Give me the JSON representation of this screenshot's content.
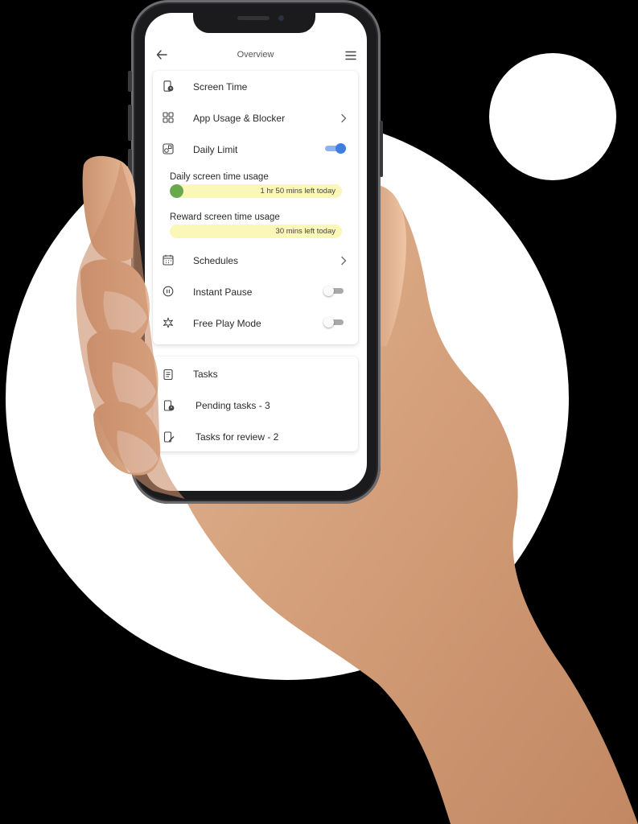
{
  "header": {
    "title": "Overview",
    "back_icon": "arrow-left-icon",
    "menu_icon": "hamburger-menu-icon"
  },
  "controls": {
    "rows": [
      {
        "label": "Screen Time",
        "icon": "phone-clock-icon"
      },
      {
        "label": "App Usage & Blocker",
        "icon": "apps-grid-icon",
        "has_chevron": true
      },
      {
        "label": "Daily Limit",
        "icon": "limit-icon",
        "toggle": "on"
      },
      {
        "label": "Schedules",
        "icon": "calendar-icon",
        "has_chevron": true
      },
      {
        "label": "Instant Pause",
        "icon": "pause-circle-icon",
        "toggle": "off"
      },
      {
        "label": "Free Play Mode",
        "icon": "sparkle-icon",
        "toggle": "off"
      }
    ],
    "usage": [
      {
        "label": "Daily screen time usage",
        "remaining": "1 hr 50 mins left today",
        "used_fraction": 0.08
      },
      {
        "label": "Reward screen time usage",
        "remaining": "30 mins left today",
        "used_fraction": 0.0
      }
    ]
  },
  "tasks": {
    "title": "Tasks",
    "title_icon": "clipboard-icon",
    "items": [
      {
        "label": "Pending tasks - 3",
        "icon": "pending-task-icon"
      },
      {
        "label": "Tasks for review - 2",
        "icon": "review-edit-icon"
      }
    ]
  },
  "colors": {
    "toggle_on": "#3f7de0",
    "bar_fill": "#6aa84f",
    "bar_track": "#fbf7b8"
  }
}
